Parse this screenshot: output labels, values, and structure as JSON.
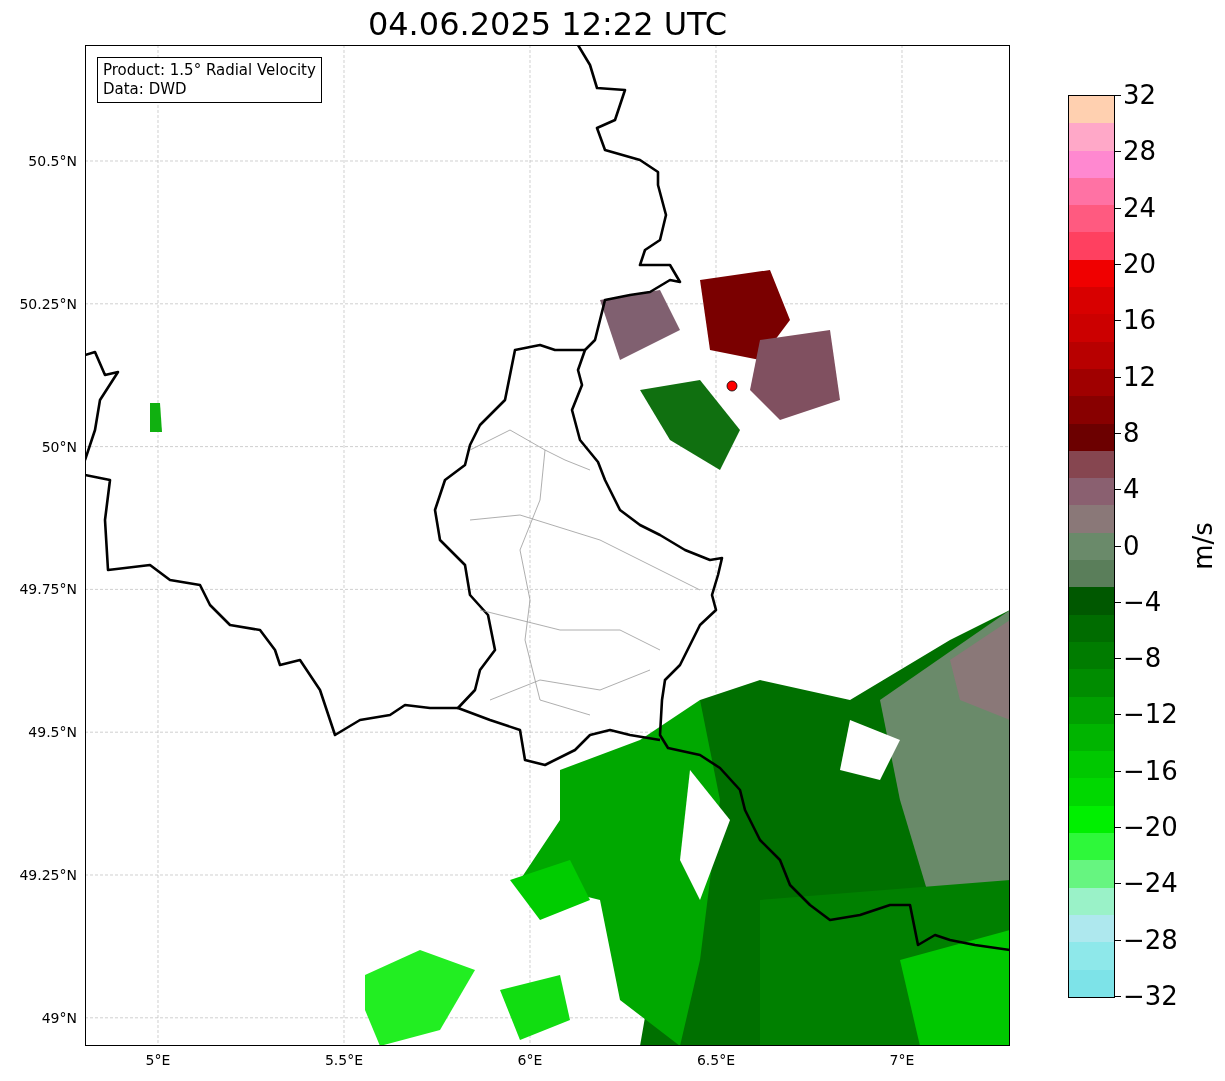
{
  "title": "04.06.2025 12:22 UTC",
  "legend": [
    "Product: 1.5° Radial Velocity",
    "Data: DWD"
  ],
  "y_ticks": [
    "50.5°N",
    "50.25°N",
    "50°N",
    "49.75°N",
    "49.5°N",
    "49.25°N",
    "49°N"
  ],
  "x_ticks": [
    "5°E",
    "5.5°E",
    "6°E",
    "6.5°E",
    "7°E"
  ],
  "colorbar": {
    "label": "m/s",
    "ticks": [
      "32",
      "28",
      "24",
      "20",
      "16",
      "12",
      "8",
      "4",
      "0",
      "−4",
      "−8",
      "−12",
      "−16",
      "−20",
      "−24",
      "−28",
      "−32"
    ],
    "bins": [
      {
        "color": "#ffd0b0"
      },
      {
        "color": "#ffa8c8"
      },
      {
        "color": "#ff88d0"
      },
      {
        "color": "#ff72a4"
      },
      {
        "color": "#ff5a80"
      },
      {
        "color": "#ff4060"
      },
      {
        "color": "#f00000"
      },
      {
        "color": "#d80000"
      },
      {
        "color": "#cc0000"
      },
      {
        "color": "#b80000"
      },
      {
        "color": "#a00000"
      },
      {
        "color": "#880000"
      },
      {
        "color": "#6c0000"
      },
      {
        "color": "#864650"
      },
      {
        "color": "#8a6070"
      },
      {
        "color": "#8a7878"
      },
      {
        "color": "#6a8a6a"
      },
      {
        "color": "#5a7e5a"
      },
      {
        "color": "#005800"
      },
      {
        "color": "#006c00"
      },
      {
        "color": "#007c00"
      },
      {
        "color": "#008c00"
      },
      {
        "color": "#00a000"
      },
      {
        "color": "#00b400"
      },
      {
        "color": "#00c800"
      },
      {
        "color": "#00d800"
      },
      {
        "color": "#00f000"
      },
      {
        "color": "#2ef83a"
      },
      {
        "color": "#66f580"
      },
      {
        "color": "#9af2c8"
      },
      {
        "color": "#aee8ee"
      },
      {
        "color": "#8ee8ea"
      },
      {
        "color": "#7de3e8"
      }
    ]
  }
}
